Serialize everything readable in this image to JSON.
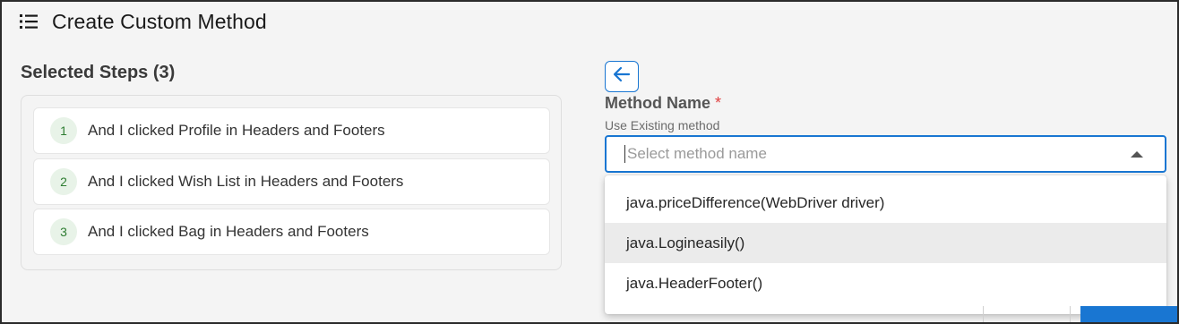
{
  "header": {
    "title": "Create Custom Method",
    "menu_icon": "list-icon"
  },
  "selected_steps": {
    "heading": "Selected Steps (3)",
    "items": [
      {
        "number": "1",
        "text": "And I clicked Profile in Headers and Footers"
      },
      {
        "number": "2",
        "text": "And I clicked Wish List in Headers and Footers"
      },
      {
        "number": "3",
        "text": "And I clicked Bag in Headers and Footers"
      }
    ]
  },
  "form": {
    "back_icon": "arrow-left-icon",
    "method_label": "Method Name",
    "required_mark": "*",
    "helper_text": "Use Existing method",
    "select_placeholder": "Select method name",
    "options": [
      "java.priceDifference(WebDriver driver)",
      "java.Logineasily()",
      "java.HeaderFooter()"
    ]
  },
  "colors": {
    "accent": "#1976d2",
    "step_badge_bg": "#e8f3e8",
    "step_badge_fg": "#2e7d32"
  }
}
